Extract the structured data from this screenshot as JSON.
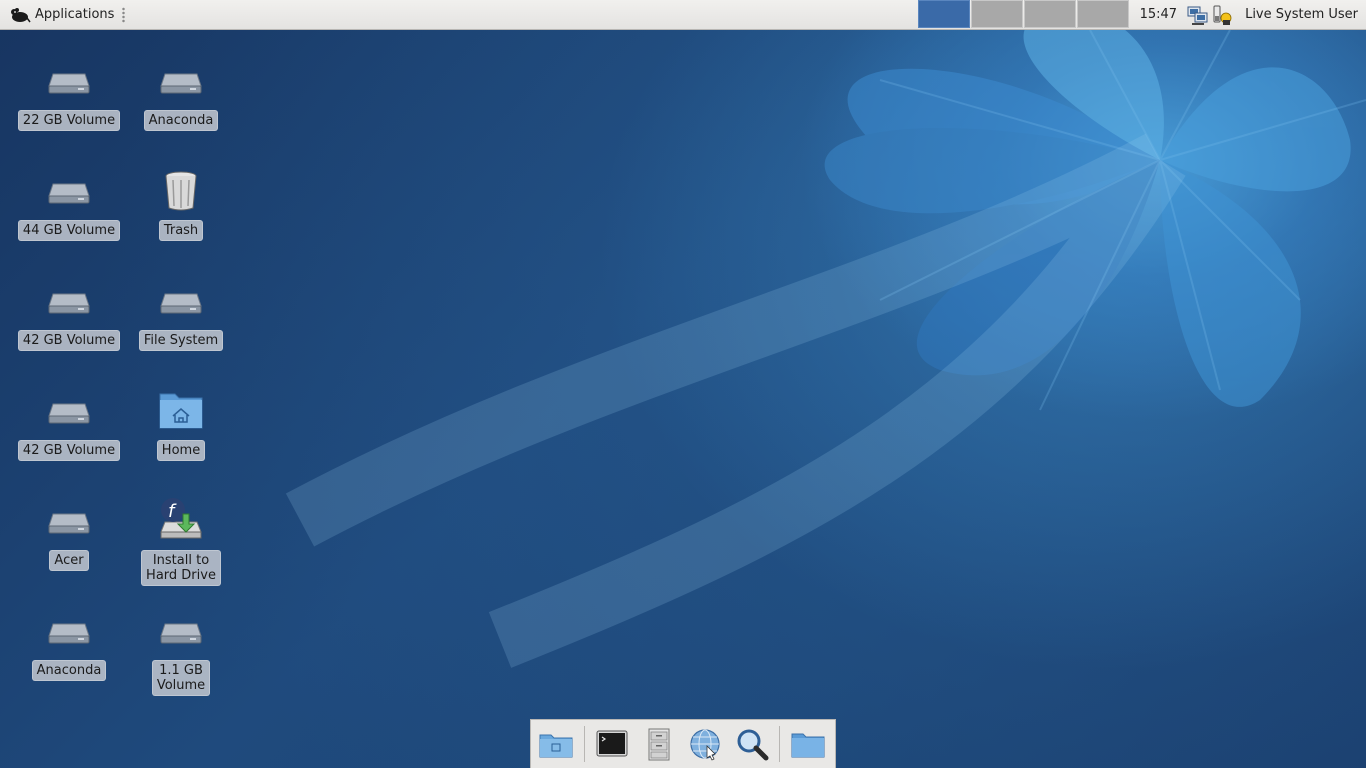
{
  "panel": {
    "applications_label": "Applications",
    "clock": "15:47",
    "user": "Live System User",
    "workspaces": [
      "",
      "",
      "",
      ""
    ]
  },
  "desktop_icons": [
    {
      "label": "22 GB Volume",
      "icon": "drive-harddisk-icon"
    },
    {
      "label": "Anaconda",
      "icon": "drive-harddisk-icon"
    },
    {
      "label": "44 GB Volume",
      "icon": "drive-harddisk-icon"
    },
    {
      "label": "Trash",
      "icon": "trash-icon"
    },
    {
      "label": "42 GB Volume",
      "icon": "drive-harddisk-icon"
    },
    {
      "label": "File System",
      "icon": "drive-harddisk-icon"
    },
    {
      "label": "42 GB Volume",
      "icon": "drive-harddisk-icon"
    },
    {
      "label": "Home",
      "icon": "home-folder-icon"
    },
    {
      "label": "Acer",
      "icon": "drive-harddisk-icon"
    },
    {
      "label": "Install to\nHard Drive",
      "icon": "fedora-install-icon"
    },
    {
      "label": "Anaconda",
      "icon": "drive-harddisk-icon"
    },
    {
      "label": "1.1 GB\nVolume",
      "icon": "drive-harddisk-icon"
    }
  ],
  "dock": {
    "items": [
      "desktop-folder-icon",
      "terminal-icon",
      "file-cabinet-icon",
      "web-browser-icon",
      "search-icon",
      "folder-icon"
    ]
  },
  "colors": {
    "active_workspace": "#3a6aa8",
    "inactive_workspace": "#a8a8a8",
    "panel_bg": "#e9e8e6"
  }
}
